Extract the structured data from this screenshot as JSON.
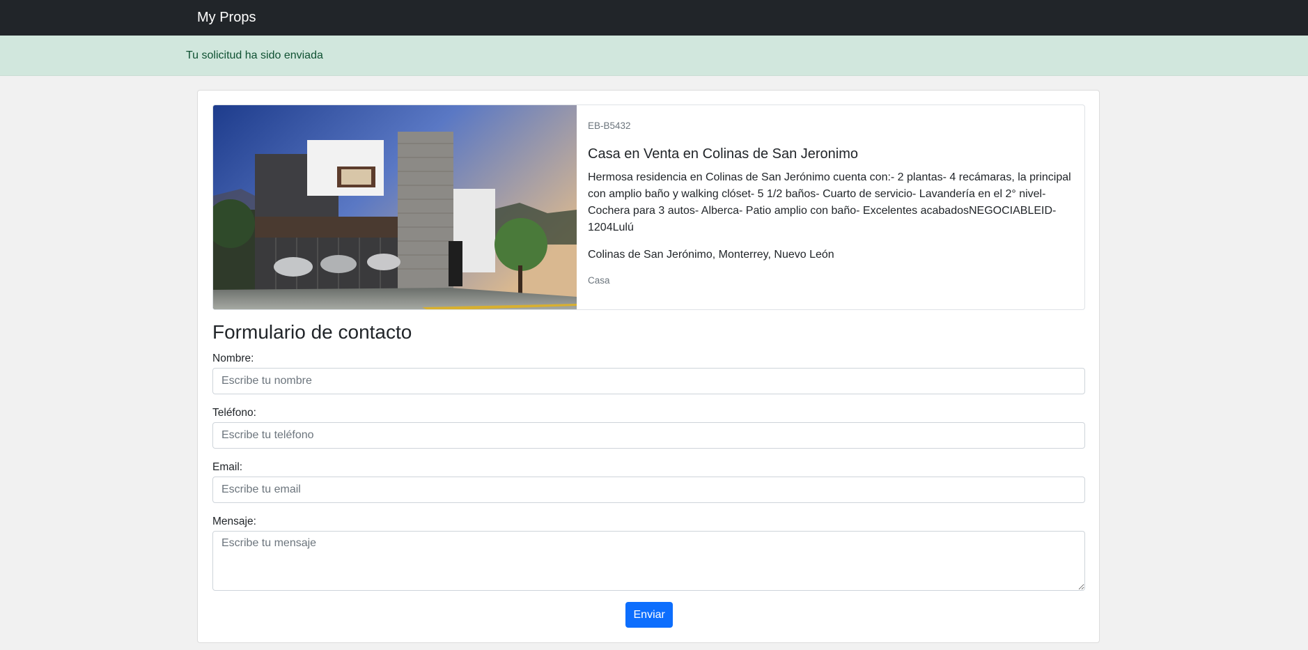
{
  "navbar": {
    "brand": "My Props"
  },
  "alert": {
    "message": "Tu solicitud ha sido enviada"
  },
  "property": {
    "code": "EB-B5432",
    "title": "Casa en Venta en Colinas de San Jeronimo",
    "description": "Hermosa residencia en Colinas de San Jerónimo cuenta con:- 2 plantas- 4 recámaras, la principal con amplio baño y walking clóset- 5 1/2 baños- Cuarto de servicio- Lavandería en el 2° nivel- Cochera para 3 autos- Alberca- Patio amplio con baño- Excelentes acabadosNEGOCIABLEID-1204Lulú",
    "location": "Colinas de San Jerónimo, Monterrey, Nuevo León",
    "type": "Casa"
  },
  "form": {
    "title": "Formulario de contacto",
    "name": {
      "label": "Nombre:",
      "placeholder": "Escribe tu nombre",
      "value": ""
    },
    "phone": {
      "label": "Teléfono:",
      "placeholder": "Escribe tu teléfono",
      "value": ""
    },
    "email": {
      "label": "Email:",
      "placeholder": "Escribe tu email",
      "value": ""
    },
    "message": {
      "label": "Mensaje:",
      "placeholder": "Escribe tu mensaje",
      "value": ""
    },
    "submit_label": "Enviar"
  },
  "colors": {
    "navbar_bg": "#212529",
    "alert_bg": "#d1e7dd",
    "alert_text": "#0f5132",
    "button_bg": "#0d6efd"
  }
}
